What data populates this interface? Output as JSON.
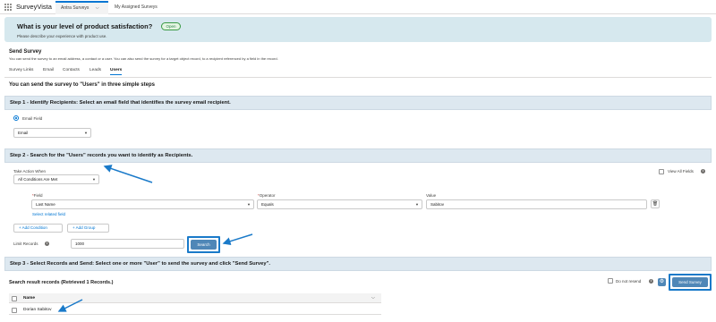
{
  "app": {
    "name": "SurveyVista",
    "nav_tabs": [
      {
        "label": "Antra Surveys",
        "active": true
      },
      {
        "label": "My Assigned Surveys",
        "active": false
      }
    ]
  },
  "header": {
    "title": "What is your level of product satisfaction?",
    "subtitle": "Please describe your experience with product use.",
    "badge": "Open"
  },
  "send_survey": {
    "title": "Send Survey",
    "description": "You can send the survey to an email address, a contact or a user. You can also send the survey for a target object record, to a recipient referenced by a field in the record.",
    "tabs": [
      "Survey Links",
      "Email",
      "Contacts",
      "Leads",
      "Users"
    ],
    "active_tab": "Users",
    "intro": "You can send the survey to \"Users\" in three simple steps"
  },
  "step1": {
    "title": "Step 1 - Identify Recipients: Select an email field that identifies the survey email recipient.",
    "radio_label": "Email Field",
    "email_select": "Email"
  },
  "step2": {
    "title": "Step 2 - Search for the \"Users\" records you want to identify as Recipients.",
    "take_action_label": "Take Action When",
    "take_action_value": "All Conditions Are Met",
    "view_all_fields": "View All Fields",
    "field_label": "Field",
    "operator_label": "Operator",
    "value_label": "Value",
    "required_mark": "*",
    "field_value": "Last Name",
    "operator_value": "Equals",
    "value_value": "Sabitov",
    "select_related": "Select related field",
    "add_condition": "+ Add Condition",
    "add_group": "+ Add Group",
    "limit_label": "Limit Records",
    "limit_value": "1000",
    "search_button": "Search"
  },
  "step3": {
    "title": "Step 3 - Select Records and Send: Select one or more \"User\" to send the survey and click \"Send Survey\".",
    "results_title": "Search result records (Retrieved 1 Records.)",
    "do_not_resend": "Do not resend",
    "send_button": "Send Survey",
    "table": {
      "header": "Name",
      "rows": [
        "Dorian Sabitov"
      ]
    }
  },
  "colors": {
    "accent": "#0176d3",
    "step_bar": "#dde8f0",
    "header_card": "#d6e8ee",
    "button_blue": "#4f87b7",
    "annotation": "#1a7ac9"
  }
}
